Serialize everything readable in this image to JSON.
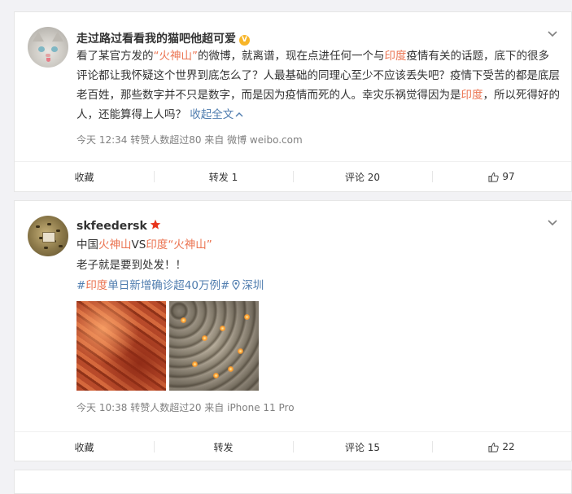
{
  "posts": [
    {
      "username": "走过路过看看我的猫吧他超可爱",
      "verified_badge": "V",
      "content_parts": [
        {
          "t": "看了某官方发的",
          "c": "text"
        },
        {
          "t": "“火神山”",
          "c": "hl"
        },
        {
          "t": "的微博，就离谱，现在点进任何一个与",
          "c": "text"
        },
        {
          "t": "印度",
          "c": "hl"
        },
        {
          "t": "疫情有关的话题，底下的很多评论都让我怀疑这个世界到底怎么了？人最基础的同理心至少不应该丢失吧？疫情下受苦的都是底层老百姓，那些数字并不只是数字，而是因为疫情而死的人。幸灾乐祸觉得因为是",
          "c": "text"
        },
        {
          "t": "印度",
          "c": "hl"
        },
        {
          "t": "，所以死得好的人，还能算得上人吗？ ",
          "c": "text"
        },
        {
          "t": "收起全文",
          "c": "fold"
        }
      ],
      "meta": "今天 12:34 转赞人数超过80  来自 微博 weibo.com",
      "actions": {
        "collect": "收藏",
        "repost": "转发 1",
        "comment": "评论 20",
        "like": "97"
      }
    },
    {
      "username": "skfeedersk",
      "line1_parts": [
        {
          "t": "中国",
          "c": "text"
        },
        {
          "t": "火神山",
          "c": "hl"
        },
        {
          "t": "VS",
          "c": "text"
        },
        {
          "t": "印度",
          "c": "hl"
        },
        {
          "t": "“火神山”",
          "c": "hl"
        }
      ],
      "line2": "老子就是要到处发！！",
      "hashtag_parts": [
        {
          "t": "#",
          "c": "blue"
        },
        {
          "t": "印度",
          "c": "hl"
        },
        {
          "t": "单日新增确诊超40万例#",
          "c": "blue"
        }
      ],
      "location": "深圳",
      "meta": "今天 10:38 转赞人数超过20  来自 iPhone 11 Pro",
      "actions": {
        "collect": "收藏",
        "repost": "转发",
        "comment": "评论 15",
        "like": "22"
      }
    }
  ],
  "colors": {
    "accent": "#eb7350",
    "link_blue": "#507daf",
    "verified": "#f7b529",
    "star": "#e8341c"
  },
  "icons": [
    "chevron-down-icon",
    "verified-icon",
    "star-icon",
    "like-icon",
    "location-icon",
    "fold-up-icon"
  ]
}
